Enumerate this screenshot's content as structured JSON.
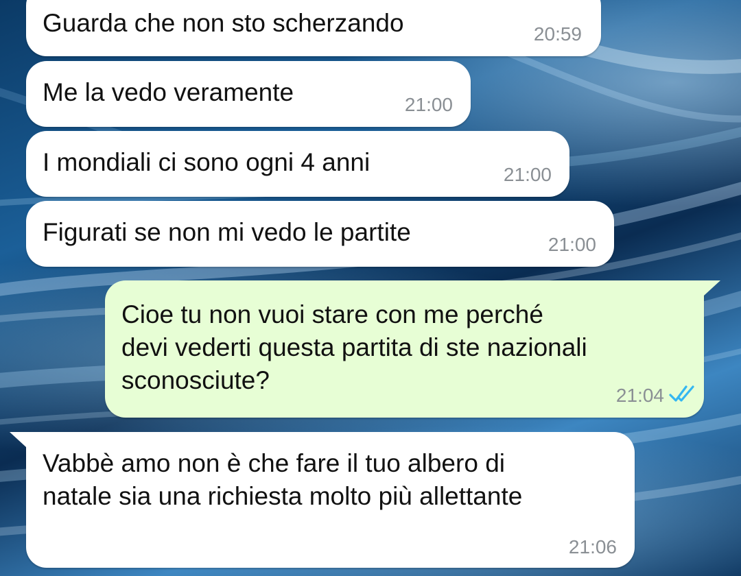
{
  "messages": [
    {
      "direction": "incoming",
      "text": "Guarda che non sto scherzando",
      "time": "20:59"
    },
    {
      "direction": "incoming",
      "text": "Me la vedo veramente",
      "time": "21:00"
    },
    {
      "direction": "incoming",
      "text": "I mondiali ci sono ogni 4 anni",
      "time": "21:00"
    },
    {
      "direction": "incoming",
      "text": "Figurati se non mi vedo le partite",
      "time": "21:00"
    },
    {
      "direction": "outgoing",
      "text": "Cioe tu non vuoi stare con me perché\ndevi vederti questa partita di ste nazionali\nsconosciute?",
      "time": "21:04",
      "status_icon": "double-check-read-icon"
    },
    {
      "direction": "incoming",
      "text": "Vabbè amo non è che fare il tuo albero di\nnatale sia una richiesta molto più allettante",
      "time": "21:06"
    }
  ],
  "colors": {
    "incoming_bubble": "#ffffff",
    "outgoing_bubble": "#e7fed5",
    "timestamp": "#8a8f94",
    "read_ticks": "#34b7f1",
    "wallpaper_base": "#0a2a4a"
  }
}
